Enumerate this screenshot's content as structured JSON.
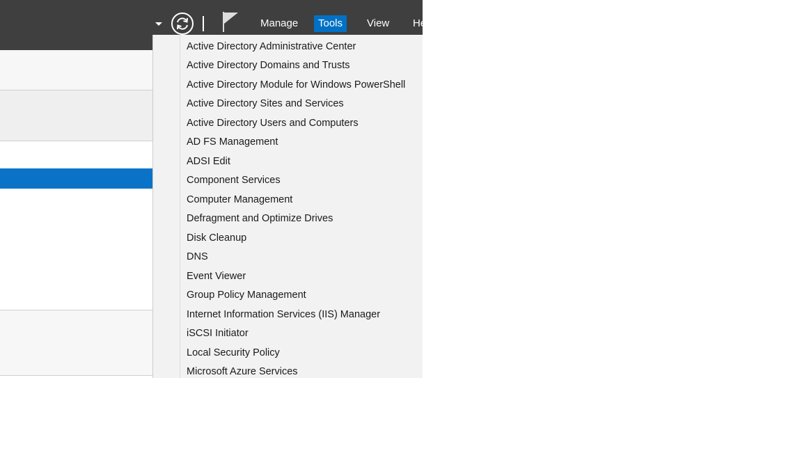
{
  "toolbar": {
    "menu": [
      "Manage",
      "Tools",
      "View",
      "He"
    ],
    "active_menu": "Tools",
    "icons": [
      "dropdown-arrow-icon",
      "refresh-icon",
      "flag-icon"
    ],
    "colors": {
      "titlebar": "#3f3f3f",
      "active_menu": "#0071c5",
      "selection": "#0a73c7"
    }
  },
  "tools_menu": {
    "items": [
      "Active Directory Administrative Center",
      "Active Directory Domains and Trusts",
      "Active Directory Module for Windows PowerShell",
      "Active Directory Sites and Services",
      "Active Directory Users and Computers",
      "AD FS Management",
      "ADSI Edit",
      "Component Services",
      "Computer Management",
      "Defragment and Optimize Drives",
      "Disk Cleanup",
      "DNS",
      "Event Viewer",
      "Group Policy Management",
      "Internet Information Services (IIS) Manager",
      "iSCSI Initiator",
      "Local Security Policy",
      "Microsoft Azure Services"
    ]
  }
}
